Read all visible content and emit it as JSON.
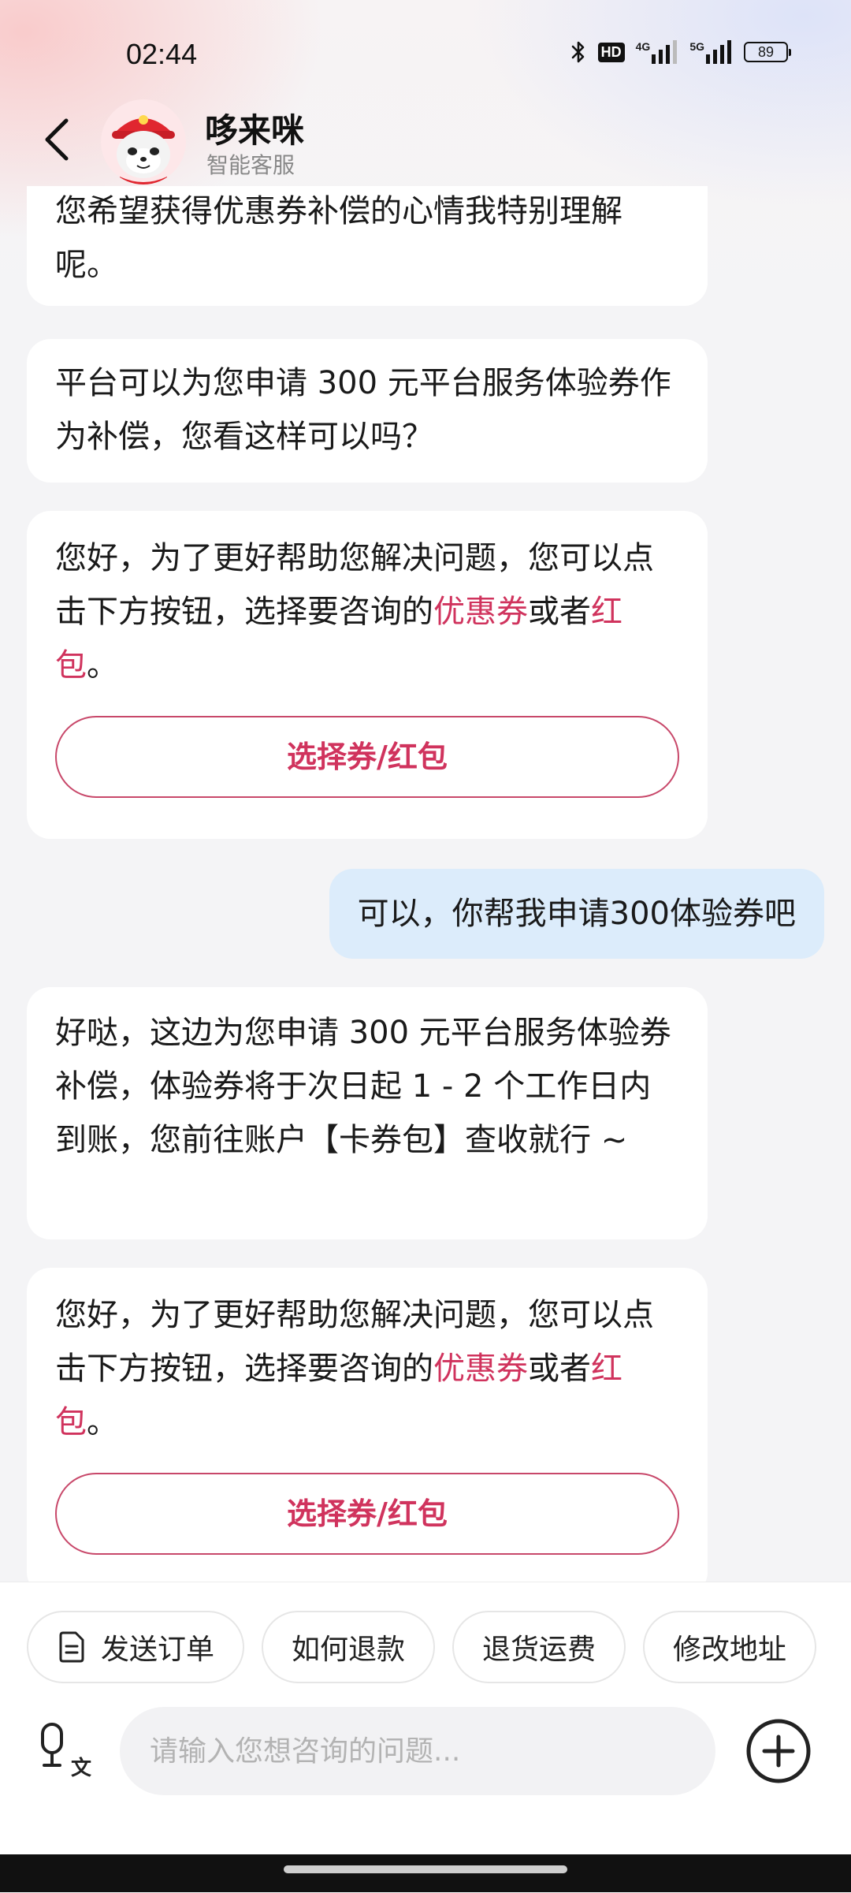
{
  "status_bar": {
    "time": "02:44",
    "hd_label": "HD",
    "network_1": "4G",
    "network_2": "5G",
    "battery": "89"
  },
  "header": {
    "name": "哆来咪",
    "subtitle": "智能客服"
  },
  "messages": [
    {
      "role": "bot",
      "text": "您希望获得优惠券补偿的心情我特别理解呢。"
    },
    {
      "role": "bot",
      "text": "平台可以为您申请 300 元平台服务体验券作为补偿，您看这样可以吗？"
    },
    {
      "role": "bot",
      "text_before": "您好，为了更好帮助您解决问题，您可以点击下方按钮，选择要咨询的",
      "highlight_1": "优惠券",
      "text_mid": "或者",
      "highlight_2": "红包",
      "text_after": "。",
      "button": "选择券/红包"
    },
    {
      "role": "user",
      "text": "可以，你帮我申请300体验券吧"
    },
    {
      "role": "bot",
      "text": "好哒，这边为您申请 300 元平台服务体验券补偿，体验券将于次日起 1 - 2 个工作日内到账，您前往账户【卡券包】查收就行 ~"
    },
    {
      "role": "bot",
      "text_before": "您好，为了更好帮助您解决问题，您可以点击下方按钮，选择要咨询的",
      "highlight_1": "优惠券",
      "text_mid": "或者",
      "highlight_2": "红包",
      "text_after": "。",
      "button": "选择券/红包"
    }
  ],
  "quick_actions": [
    {
      "label": "发送订单",
      "icon": "document-icon"
    },
    {
      "label": "如何退款"
    },
    {
      "label": "退货运费"
    },
    {
      "label": "修改地址"
    }
  ],
  "input": {
    "placeholder": "请输入您想咨询的问题...",
    "value": "",
    "voice_icon": "voice-to-text-icon",
    "plus_icon": "plus-circle-icon"
  },
  "colors": {
    "accent": "#d0335d",
    "user_bubble": "#dcecfb",
    "bot_bubble": "#ffffff",
    "background": "#f4f4f6"
  }
}
